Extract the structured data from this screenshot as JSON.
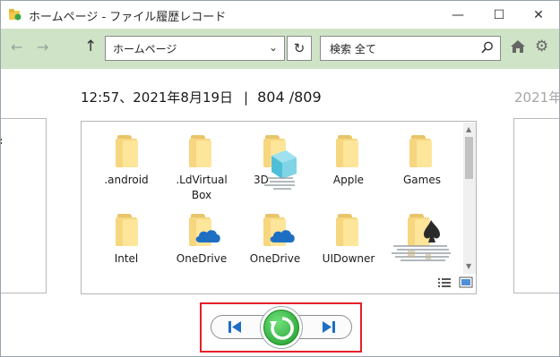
{
  "window": {
    "title": "ホームページ - ファイル履歴レコード",
    "minimize_glyph": "—",
    "maximize_glyph": "☐",
    "close_glyph": "✕"
  },
  "nav": {
    "back_glyph": "←",
    "forward_glyph": "→",
    "up_glyph": "↑",
    "address_value": "ホームページ",
    "refresh_glyph": "↻",
    "search_value": "検索  全て",
    "icons": [
      "back-arrow-icon",
      "forward-arrow-icon",
      "up-arrow-icon",
      "chevron-down-icon",
      "refresh-icon",
      "search-icon",
      "home-icon",
      "gear-icon"
    ]
  },
  "snapshot": {
    "time_date": "12:57、2021年8月19日",
    "separator": "|",
    "counter": "804 /809",
    "next_date": "2021年"
  },
  "files": [
    {
      "label": ".android",
      "icon": "folder-icon"
    },
    {
      "label": ".LdVirtual Box",
      "icon": "folder-icon"
    },
    {
      "label": "3D",
      "icon": "folder-icon"
    },
    {
      "label": "Apple",
      "icon": "folder-icon"
    },
    {
      "label": "Games",
      "icon": "folder-icon"
    },
    {
      "label": "Intel",
      "icon": "folder-icon"
    },
    {
      "label": "OneDrive",
      "icon": "onedrive-folder-icon"
    },
    {
      "label": "OneDrive",
      "icon": "onedrive-folder-icon"
    },
    {
      "label": "UIDowner",
      "icon": "folder-icon"
    },
    {
      "label": "",
      "icon": "folder-icon"
    }
  ],
  "controls": {
    "previous": "previous-version-icon",
    "restore": "restore-icon",
    "next": "next-version-icon"
  },
  "colors": {
    "navbar": "#cfe3c7",
    "folder": "#f6d67e",
    "restore_green": "#1f9a2a",
    "highlight_red": "#e4202b",
    "nav_blue": "#1e6fc4"
  }
}
